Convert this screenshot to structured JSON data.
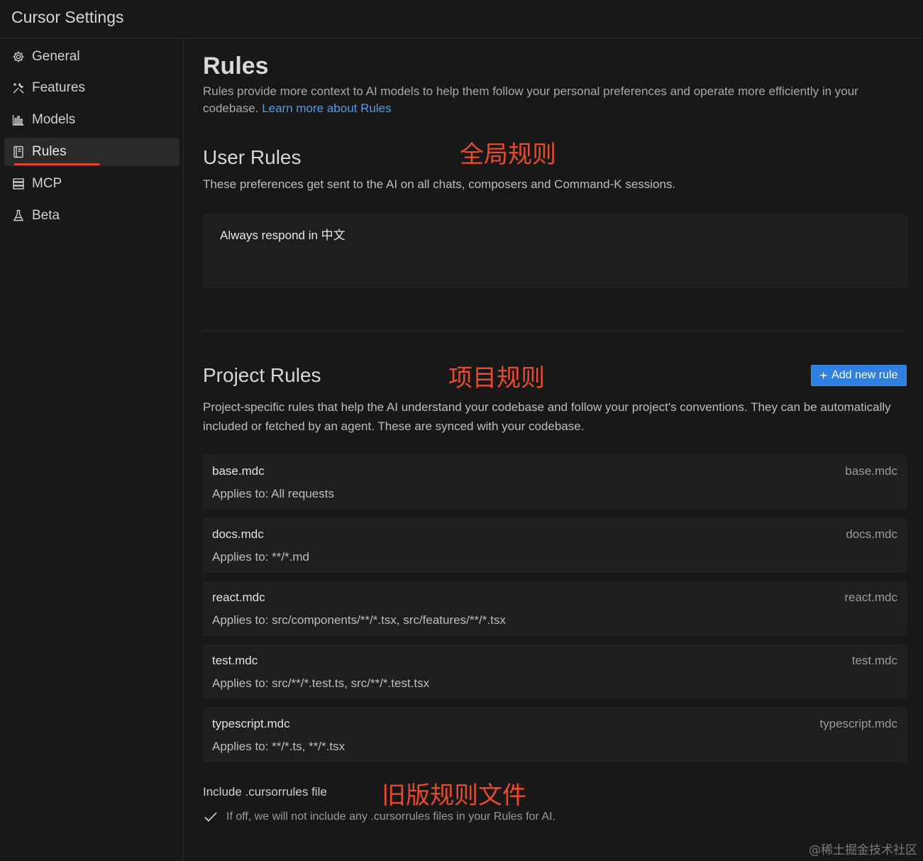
{
  "window": {
    "title": "Cursor Settings"
  },
  "sidebar": {
    "items": [
      {
        "label": "General",
        "icon": "gear-icon"
      },
      {
        "label": "Features",
        "icon": "tools-icon"
      },
      {
        "label": "Models",
        "icon": "bar-chart-icon"
      },
      {
        "label": "Rules",
        "icon": "book-icon",
        "active": true
      },
      {
        "label": "MCP",
        "icon": "server-icon"
      },
      {
        "label": "Beta",
        "icon": "flask-icon"
      }
    ]
  },
  "page": {
    "title": "Rules",
    "description": "Rules provide more context to AI models to help them follow your personal preferences and operate more efficiently in your codebase.",
    "learn_more": "Learn more about Rules"
  },
  "user_rules": {
    "title": "User Rules",
    "annotation": "全局规则",
    "description": "These preferences get sent to the AI on all chats, composers and Command-K sessions.",
    "value": "Always respond in 中文"
  },
  "project_rules": {
    "title": "Project Rules",
    "annotation": "项目规则",
    "add_button": "Add new rule",
    "description": "Project-specific rules that help the AI understand your codebase and follow your project's conventions. They can be automatically included or fetched by an agent. These are synced with your codebase.",
    "rules": [
      {
        "name": "base.mdc",
        "applies": "Applies to: All requests",
        "file": "base.mdc"
      },
      {
        "name": "docs.mdc",
        "applies": "Applies to: **/*.md",
        "file": "docs.mdc"
      },
      {
        "name": "react.mdc",
        "applies": "Applies to: src/components/**/*.tsx, src/features/**/*.tsx",
        "file": "react.mdc"
      },
      {
        "name": "test.mdc",
        "applies": "Applies to: src/**/*.test.ts, src/**/*.test.tsx",
        "file": "test.mdc"
      },
      {
        "name": "typescript.mdc",
        "applies": "Applies to: **/*.ts, **/*.tsx",
        "file": "typescript.mdc"
      }
    ]
  },
  "cursorrules": {
    "label": "Include .cursorrules file",
    "annotation": "旧版规则文件",
    "checked": true,
    "description": "If off, we will not include any .cursorrules files in your Rules for AI."
  },
  "watermark": "@稀土掘金技术社区",
  "colors": {
    "accent": "#2f7fe0",
    "annotation": "#e84a2e",
    "link": "#4e9de8"
  }
}
